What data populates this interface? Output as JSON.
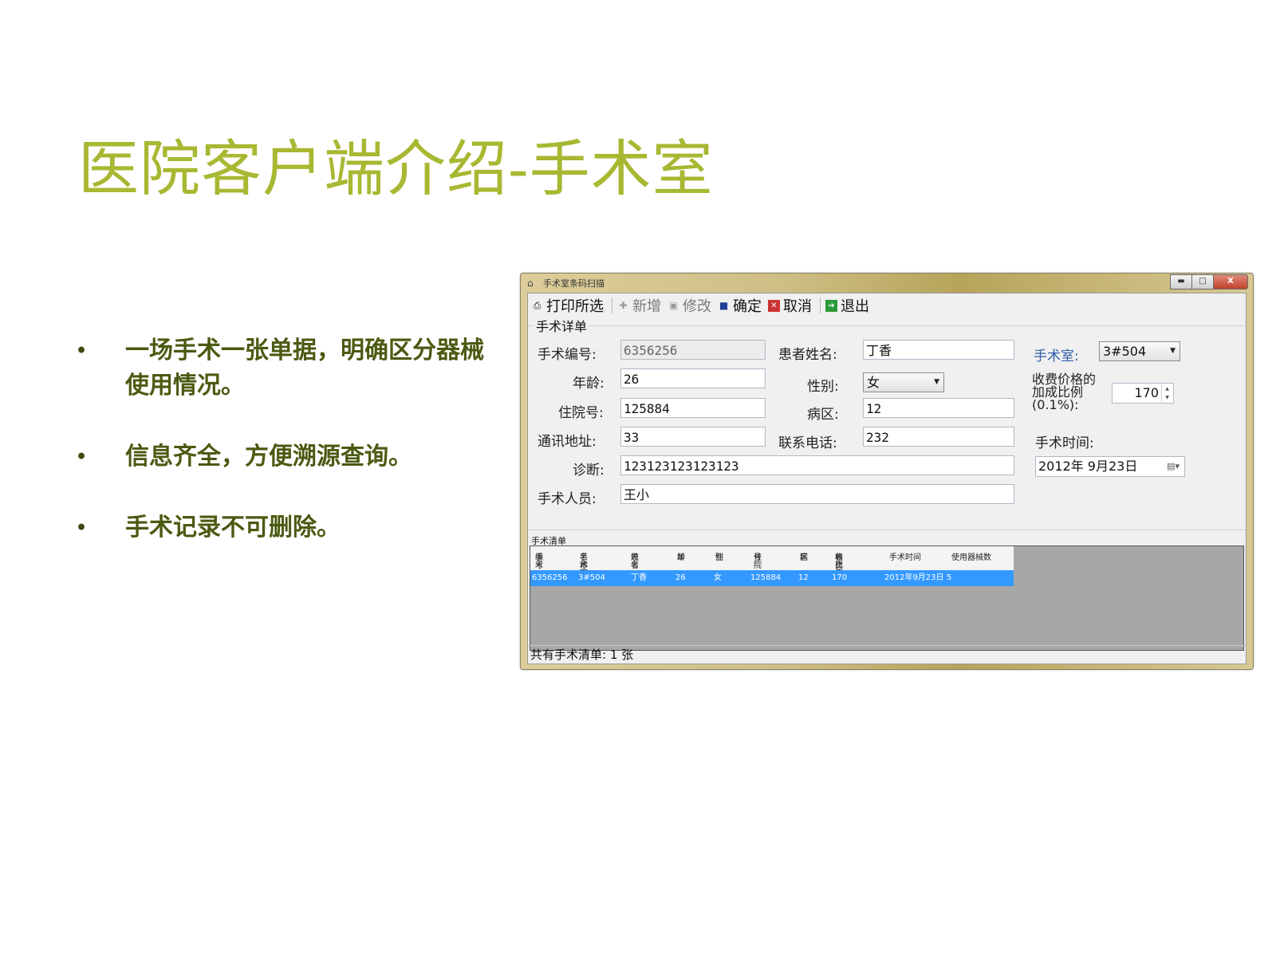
{
  "slide": {
    "title": "医院客户端介绍-手术室",
    "bullets": [
      "一场手术一张单据，明确区分器械使用情况。",
      "信息齐全，方便溯源查询。",
      "手术记录不可删除。"
    ],
    "bullet_glyph": "•"
  },
  "window": {
    "title": "手术室条码扫描",
    "controls": {
      "minimize": "▬",
      "maximize": "□",
      "close": "X"
    }
  },
  "toolbar": {
    "print": "打印所选",
    "new": "新增",
    "edit": "修改",
    "confirm": "确定",
    "cancel": "取消",
    "exit": "退出"
  },
  "form": {
    "group_title": "手术详单",
    "surgery_no_label": "手术编号:",
    "surgery_no": "6356256",
    "patient_name_label": "患者姓名:",
    "patient_name": "丁香",
    "or_room_label": "手术室:",
    "or_room": "3#504",
    "age_label": "年龄:",
    "age": "26",
    "gender_label": "性别:",
    "gender": "女",
    "markup_label_1": "收费价格的",
    "markup_label_2": "加成比例",
    "markup_label_3": "(0.1%):",
    "markup": "170",
    "admission_no_label": "住院号:",
    "admission_no": "125884",
    "ward_label": "病区:",
    "ward": "12",
    "address_label": "通讯地址:",
    "address": "33",
    "phone_label": "联系电话:",
    "phone": "232",
    "surgery_time_label": "手术时间:",
    "surgery_time": "2012年  9月23日",
    "diagnosis_label": "诊断:",
    "diagnosis": "123123123123123",
    "staff_label": "手术人员:",
    "staff": "王小"
  },
  "list": {
    "title": "手术清单",
    "columns": [
      [
        "手术",
        "编号"
      ],
      [
        "手术室",
        "名称"
      ],
      [
        "患者",
        "姓名"
      ],
      [
        "年",
        "龄"
      ],
      [
        "性",
        "别"
      ],
      [
        "住院",
        "号"
      ],
      [
        "病",
        "区"
      ],
      [
        "收费价",
        "格比例"
      ],
      [
        "手术时间",
        ""
      ],
      [
        "使用器械数",
        ""
      ]
    ],
    "rows": [
      [
        "6356256",
        "3#504",
        "丁香",
        "26",
        "女",
        "125884",
        "12",
        "170",
        "2012年9月23日",
        "5"
      ]
    ]
  },
  "status": "共有手术清单: 1 张",
  "colors": {
    "title_green": "#a8b832",
    "bullet_text": "#4b5a12",
    "selection_blue": "#3399ff",
    "label_blue": "#2e5fa8"
  }
}
